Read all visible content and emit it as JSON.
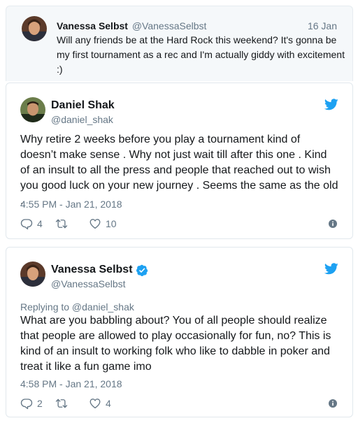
{
  "quoted": {
    "name": "Vanessa Selbst",
    "handle": "@VanessaSelbst",
    "date": "16 Jan",
    "text": "Will any friends be at the Hard Rock this weekend? It's gonna be my first tournament as a rec and I'm actually giddy with excitement :)"
  },
  "tweets": [
    {
      "name": "Daniel Shak",
      "handle": "@daniel_shak",
      "verified": false,
      "reply_to": "",
      "text": "Why retire 2 weeks before you play a tournament kind of doesn’t make sense . Why not just wait till after this one . Kind of an insult to all the press and people that reached out to wish you good luck on your new journey . Seems the same as the old .",
      "time": "4:55 PM - Jan 21, 2018",
      "replies": "4",
      "retweets": "",
      "likes": "10"
    },
    {
      "name": "Vanessa Selbst",
      "handle": "@VanessaSelbst",
      "verified": true,
      "reply_to": "Replying to @daniel_shak",
      "text": "What are you babbling about? You of all people should realize that people are allowed to play occasionally for fun, no? This is kind of an insult to working folk who like to dabble in poker and treat it like a fun game imo",
      "time": "4:58 PM - Jan 21, 2018",
      "replies": "2",
      "retweets": "",
      "likes": "4"
    }
  ],
  "colors": {
    "twitter_blue": "#1da1f2",
    "secondary_text": "#657786",
    "primary_text": "#14171a",
    "quoted_bg": "#f5f8fa"
  },
  "icons": [
    "twitter-bird-icon",
    "verified-badge-icon",
    "reply-icon",
    "retweet-icon",
    "like-icon",
    "info-icon"
  ]
}
